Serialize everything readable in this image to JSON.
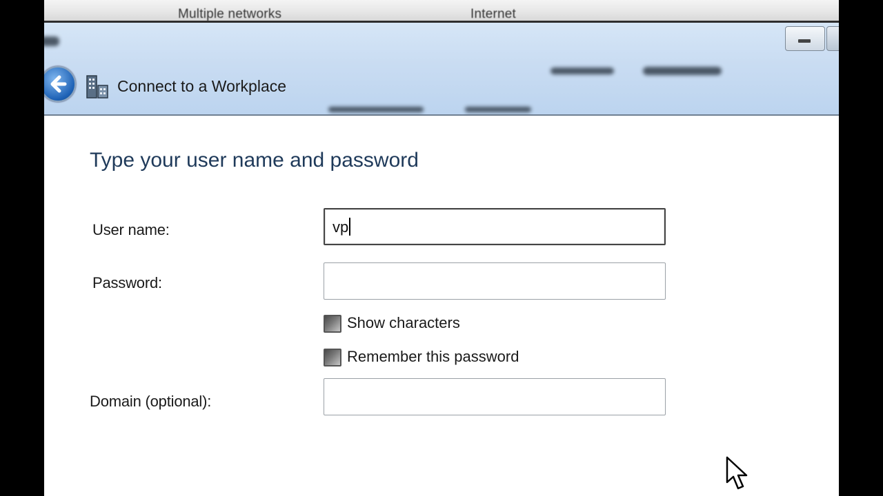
{
  "taskbar": {
    "items": [
      {
        "label": "Multiple networks"
      },
      {
        "label": "Internet"
      }
    ]
  },
  "window": {
    "title": "Connect to a Workplace",
    "back_icon": "back-arrow-icon",
    "app_icon": "workplace-network-icon"
  },
  "form": {
    "heading": "Type your user name and password",
    "username": {
      "label": "User name:",
      "value": "vp"
    },
    "password": {
      "label": "Password:",
      "value": ""
    },
    "show_characters": {
      "label": "Show characters",
      "checked": false
    },
    "remember_password": {
      "label": "Remember this password",
      "checked": false
    },
    "domain": {
      "label": "Domain (optional):",
      "value": ""
    }
  },
  "colors": {
    "title_bar": "#c9dcf2",
    "heading": "#1f3a5a",
    "back_button": "#1d61b5"
  }
}
